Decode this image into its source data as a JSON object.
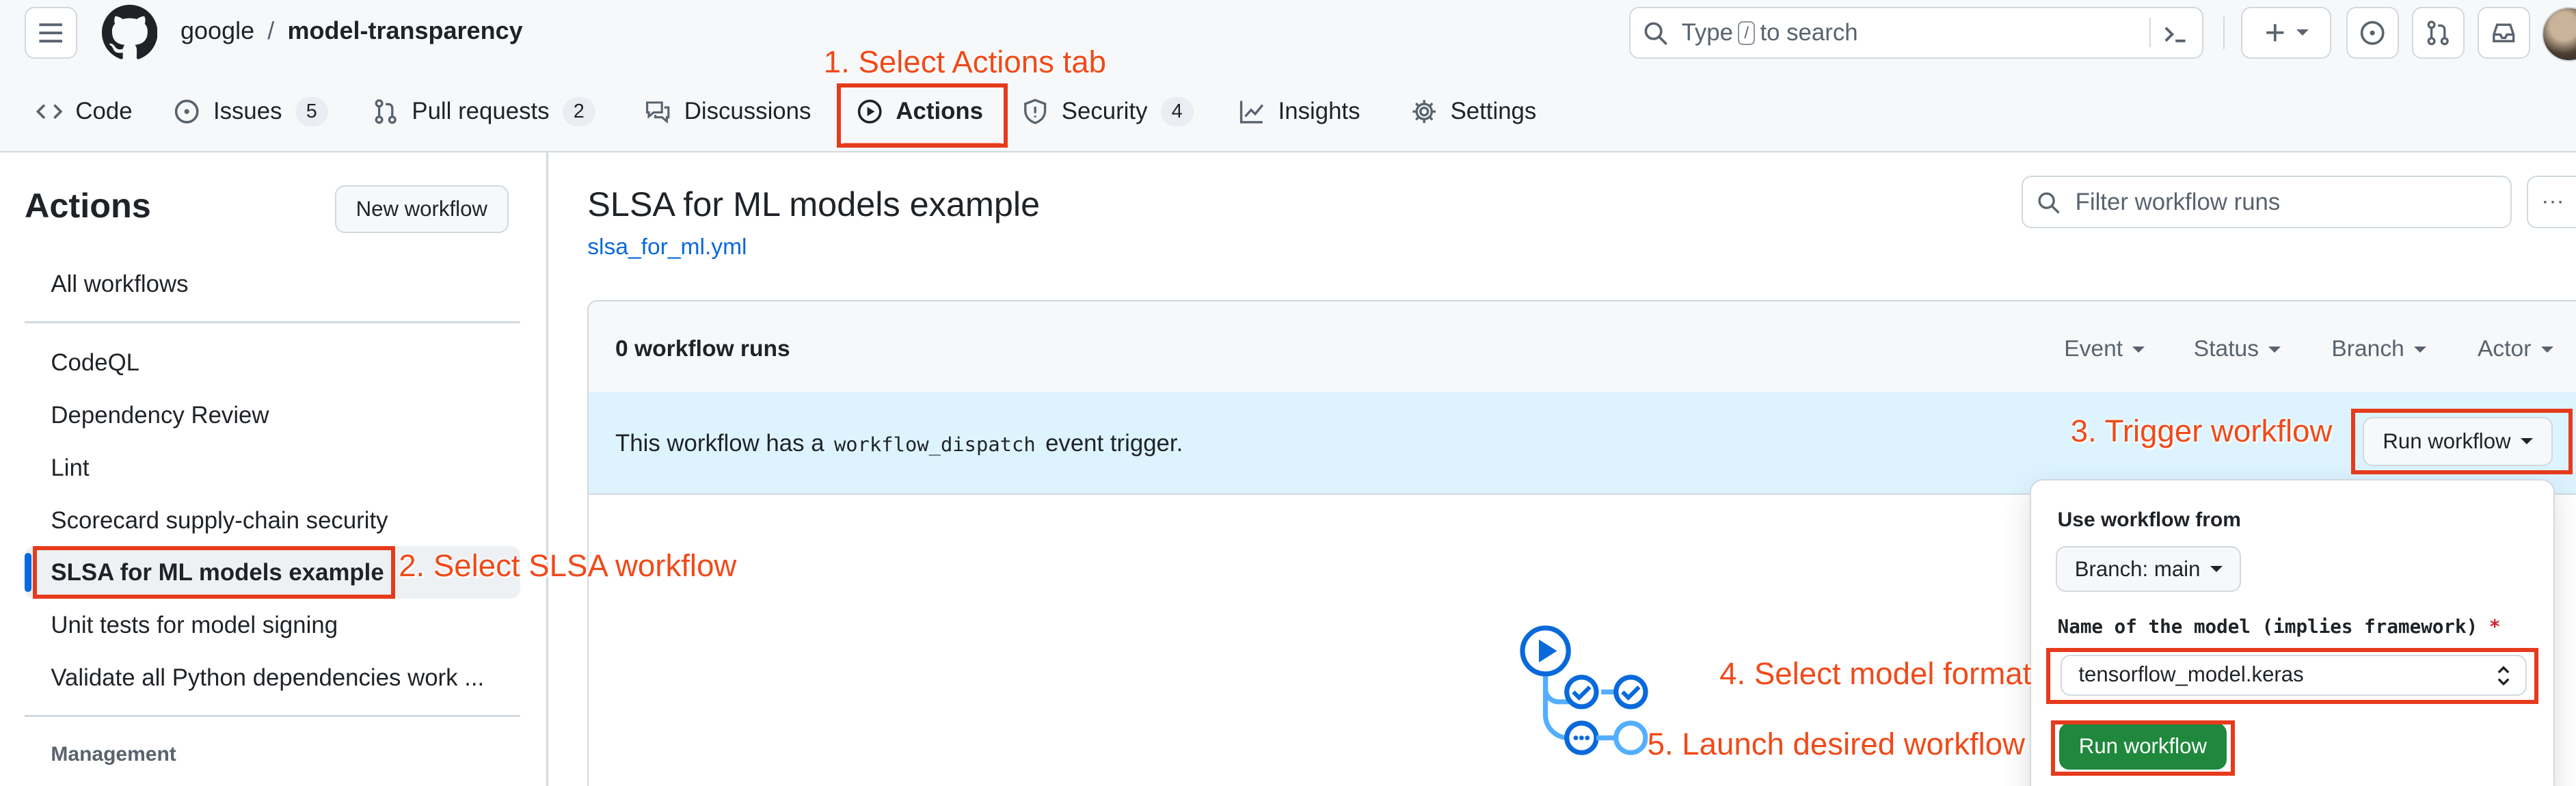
{
  "header": {
    "owner": "google",
    "separator": "/",
    "repo": "model-transparency",
    "search": {
      "prefix": "Type",
      "key": "/",
      "suffix": "to search"
    }
  },
  "tabs": [
    {
      "label": "Code",
      "icon": "code-icon"
    },
    {
      "label": "Issues",
      "icon": "issue-icon",
      "count": "5"
    },
    {
      "label": "Pull requests",
      "icon": "pull-request-icon",
      "count": "2"
    },
    {
      "label": "Discussions",
      "icon": "discussions-icon"
    },
    {
      "label": "Actions",
      "icon": "play-icon",
      "selected": true
    },
    {
      "label": "Security",
      "icon": "shield-icon",
      "count": "4"
    },
    {
      "label": "Insights",
      "icon": "graph-icon"
    },
    {
      "label": "Settings",
      "icon": "gear-icon"
    }
  ],
  "sidebar": {
    "title": "Actions",
    "new_workflow": "New workflow",
    "all_workflows": "All workflows",
    "items": [
      "CodeQL",
      "Dependency Review",
      "Lint",
      "Scorecard supply-chain security",
      "SLSA for ML models example",
      "Unit tests for model signing",
      "Validate all Python dependencies work ..."
    ],
    "selected_index": 4,
    "section_management": "Management"
  },
  "main": {
    "title": "SLSA for ML models example",
    "file_link": "slsa_for_ml.yml",
    "filter_placeholder": "Filter workflow runs",
    "runs_count": "0 workflow runs",
    "filters": [
      "Event",
      "Status",
      "Branch",
      "Actor"
    ],
    "dispatch_prefix": "This workflow has a",
    "dispatch_code": "workflow_dispatch",
    "dispatch_suffix": "event trigger.",
    "run_workflow_button": "Run workflow"
  },
  "dropdown": {
    "use_from_label": "Use workflow from",
    "branch_button": "Branch: main",
    "input_label": "Name of the model (implies framework)",
    "required_mark": "*",
    "selected_model": "tensorflow_model.keras",
    "submit_button": "Run workflow"
  },
  "annotations": {
    "step1": "1. Select Actions tab",
    "step2": "2. Select SLSA workflow",
    "step3": "3. Trigger workflow",
    "step4": "4. Select model format",
    "step5": "5. Launch desired workflow"
  },
  "colors": {
    "accent_blue": "#0969da",
    "annotation_red": "#e53b1c",
    "primary_green": "#1f883d",
    "dispatch_banner": "#ddf4ff",
    "selected_indicator": "#0969da"
  }
}
